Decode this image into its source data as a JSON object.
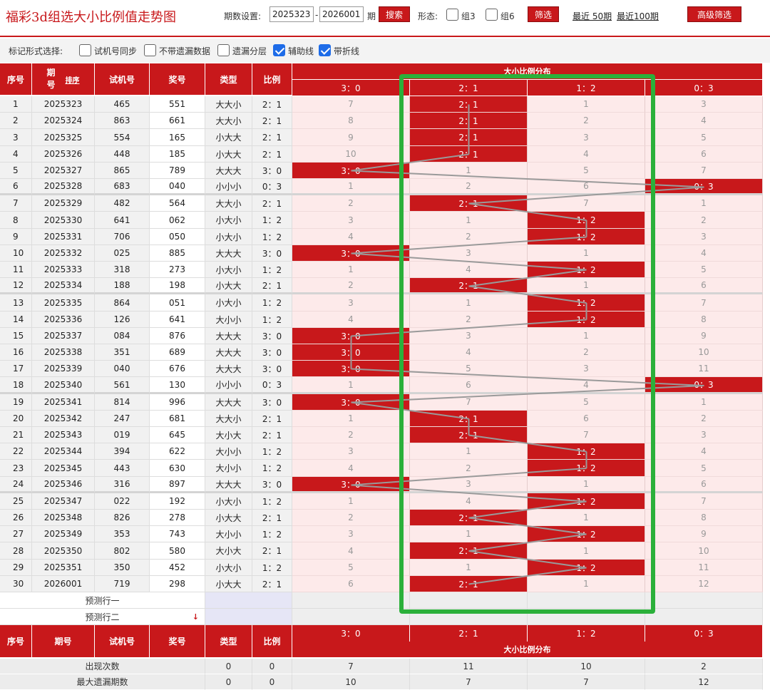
{
  "header": {
    "title": "福彩3d组选大小比例值走势图",
    "period_label": "期数设置:",
    "period_from": "2025323",
    "period_dash": "-",
    "period_to": "2026001",
    "period_unit": "期",
    "search_btn": "搜索",
    "shape_label": "形态:",
    "shape_opts": [
      "组3",
      "组6"
    ],
    "filter_btn": "筛选",
    "recent50": "最近 50期",
    "recent100": "最近100期",
    "advanced_btn": "高级筛选"
  },
  "marks": {
    "label": "标记形式选择:",
    "options": [
      {
        "label": "试机号同步",
        "checked": false
      },
      {
        "label": "不带遗漏数据",
        "checked": false
      },
      {
        "label": "遗漏分层",
        "checked": false
      },
      {
        "label": "辅助线",
        "checked": true
      },
      {
        "label": "带折线",
        "checked": true
      }
    ]
  },
  "table": {
    "headers": {
      "seq": "序号",
      "issue": "期号",
      "sort": "排序",
      "trial": "试机号",
      "prize": "奖号",
      "type": "类型",
      "ratio": "比例",
      "dist": "大小比例分布"
    },
    "dist_cols": [
      "3：0",
      "2：1",
      "1：2",
      "0：3"
    ],
    "rows": [
      {
        "seq": "1",
        "issue": "2025323",
        "trial": "465",
        "prize": "551",
        "type": "大大小",
        "ratio": "2：1",
        "dist": [
          "7",
          "2：1",
          "1",
          "3"
        ],
        "hit": 1
      },
      {
        "seq": "2",
        "issue": "2025324",
        "trial": "863",
        "prize": "661",
        "type": "大大小",
        "ratio": "2：1",
        "dist": [
          "8",
          "2：1",
          "2",
          "4"
        ],
        "hit": 1
      },
      {
        "seq": "3",
        "issue": "2025325",
        "trial": "554",
        "prize": "165",
        "type": "小大大",
        "ratio": "2：1",
        "dist": [
          "9",
          "2：1",
          "3",
          "5"
        ],
        "hit": 1
      },
      {
        "seq": "4",
        "issue": "2025326",
        "trial": "448",
        "prize": "185",
        "type": "小大大",
        "ratio": "2：1",
        "dist": [
          "10",
          "2：1",
          "4",
          "6"
        ],
        "hit": 1
      },
      {
        "seq": "5",
        "issue": "2025327",
        "trial": "865",
        "prize": "789",
        "type": "大大大",
        "ratio": "3：0",
        "dist": [
          "3：0",
          "1",
          "5",
          "7"
        ],
        "hit": 0
      },
      {
        "seq": "6",
        "issue": "2025328",
        "trial": "683",
        "prize": "040",
        "type": "小小小",
        "ratio": "0：3",
        "dist": [
          "1",
          "2",
          "6",
          "0：3"
        ],
        "hit": 3
      },
      {
        "seq": "7",
        "issue": "2025329",
        "trial": "482",
        "prize": "564",
        "type": "大大小",
        "ratio": "2：1",
        "dist": [
          "2",
          "2：1",
          "7",
          "1"
        ],
        "hit": 1
      },
      {
        "seq": "8",
        "issue": "2025330",
        "trial": "641",
        "prize": "062",
        "type": "小大小",
        "ratio": "1：2",
        "dist": [
          "3",
          "1",
          "1：2",
          "2"
        ],
        "hit": 2
      },
      {
        "seq": "9",
        "issue": "2025331",
        "trial": "706",
        "prize": "050",
        "type": "小大小",
        "ratio": "1：2",
        "dist": [
          "4",
          "2",
          "1：2",
          "3"
        ],
        "hit": 2
      },
      {
        "seq": "10",
        "issue": "2025332",
        "trial": "025",
        "prize": "885",
        "type": "大大大",
        "ratio": "3：0",
        "dist": [
          "3：0",
          "3",
          "1",
          "4"
        ],
        "hit": 0
      },
      {
        "seq": "11",
        "issue": "2025333",
        "trial": "318",
        "prize": "273",
        "type": "小大小",
        "ratio": "1：2",
        "dist": [
          "1",
          "4",
          "1：2",
          "5"
        ],
        "hit": 2
      },
      {
        "seq": "12",
        "issue": "2025334",
        "trial": "188",
        "prize": "198",
        "type": "小大大",
        "ratio": "2：1",
        "dist": [
          "2",
          "2：1",
          "1",
          "6"
        ],
        "hit": 1
      },
      {
        "seq": "13",
        "issue": "2025335",
        "trial": "864",
        "prize": "051",
        "type": "小大小",
        "ratio": "1：2",
        "dist": [
          "3",
          "1",
          "1：2",
          "7"
        ],
        "hit": 2
      },
      {
        "seq": "14",
        "issue": "2025336",
        "trial": "126",
        "prize": "641",
        "type": "大小小",
        "ratio": "1：2",
        "dist": [
          "4",
          "2",
          "1：2",
          "8"
        ],
        "hit": 2
      },
      {
        "seq": "15",
        "issue": "2025337",
        "trial": "084",
        "prize": "876",
        "type": "大大大",
        "ratio": "3：0",
        "dist": [
          "3：0",
          "3",
          "1",
          "9"
        ],
        "hit": 0
      },
      {
        "seq": "16",
        "issue": "2025338",
        "trial": "351",
        "prize": "689",
        "type": "大大大",
        "ratio": "3：0",
        "dist": [
          "3：0",
          "4",
          "2",
          "10"
        ],
        "hit": 0
      },
      {
        "seq": "17",
        "issue": "2025339",
        "trial": "040",
        "prize": "676",
        "type": "大大大",
        "ratio": "3：0",
        "dist": [
          "3：0",
          "5",
          "3",
          "11"
        ],
        "hit": 0
      },
      {
        "seq": "18",
        "issue": "2025340",
        "trial": "561",
        "prize": "130",
        "type": "小小小",
        "ratio": "0：3",
        "dist": [
          "1",
          "6",
          "4",
          "0：3"
        ],
        "hit": 3
      },
      {
        "seq": "19",
        "issue": "2025341",
        "trial": "814",
        "prize": "996",
        "type": "大大大",
        "ratio": "3：0",
        "dist": [
          "3：0",
          "7",
          "5",
          "1"
        ],
        "hit": 0
      },
      {
        "seq": "20",
        "issue": "2025342",
        "trial": "247",
        "prize": "681",
        "type": "大大小",
        "ratio": "2：1",
        "dist": [
          "1",
          "2：1",
          "6",
          "2"
        ],
        "hit": 1
      },
      {
        "seq": "21",
        "issue": "2025343",
        "trial": "019",
        "prize": "645",
        "type": "大小大",
        "ratio": "2：1",
        "dist": [
          "2",
          "2：1",
          "7",
          "3"
        ],
        "hit": 1
      },
      {
        "seq": "22",
        "issue": "2025344",
        "trial": "394",
        "prize": "622",
        "type": "大小小",
        "ratio": "1：2",
        "dist": [
          "3",
          "1",
          "1：2",
          "4"
        ],
        "hit": 2
      },
      {
        "seq": "23",
        "issue": "2025345",
        "trial": "443",
        "prize": "630",
        "type": "大小小",
        "ratio": "1：2",
        "dist": [
          "4",
          "2",
          "1：2",
          "5"
        ],
        "hit": 2
      },
      {
        "seq": "24",
        "issue": "2025346",
        "trial": "316",
        "prize": "897",
        "type": "大大大",
        "ratio": "3：0",
        "dist": [
          "3：0",
          "3",
          "1",
          "6"
        ],
        "hit": 0
      },
      {
        "seq": "25",
        "issue": "2025347",
        "trial": "022",
        "prize": "192",
        "type": "小大小",
        "ratio": "1：2",
        "dist": [
          "1",
          "4",
          "1：2",
          "7"
        ],
        "hit": 2
      },
      {
        "seq": "26",
        "issue": "2025348",
        "trial": "826",
        "prize": "278",
        "type": "小大大",
        "ratio": "2：1",
        "dist": [
          "2",
          "2：1",
          "1",
          "8"
        ],
        "hit": 1
      },
      {
        "seq": "27",
        "issue": "2025349",
        "trial": "353",
        "prize": "743",
        "type": "大小小",
        "ratio": "1：2",
        "dist": [
          "3",
          "1",
          "1：2",
          "9"
        ],
        "hit": 2
      },
      {
        "seq": "28",
        "issue": "2025350",
        "trial": "802",
        "prize": "580",
        "type": "大小大",
        "ratio": "2：1",
        "dist": [
          "4",
          "2：1",
          "1",
          "10"
        ],
        "hit": 1
      },
      {
        "seq": "29",
        "issue": "2025351",
        "trial": "350",
        "prize": "452",
        "type": "小大小",
        "ratio": "1：2",
        "dist": [
          "5",
          "1",
          "1：2",
          "11"
        ],
        "hit": 2
      },
      {
        "seq": "30",
        "issue": "2026001",
        "trial": "719",
        "prize": "298",
        "type": "小大大",
        "ratio": "2：1",
        "dist": [
          "6",
          "2：1",
          "1",
          "12"
        ],
        "hit": 1
      }
    ],
    "predict": [
      "预测行一",
      "预测行二"
    ],
    "stats": [
      {
        "label": "出现次数",
        "type": "0",
        "ratio": "0",
        "values": [
          "7",
          "11",
          "10",
          "2"
        ]
      },
      {
        "label": "最大遗漏期数",
        "type": "0",
        "ratio": "0",
        "values": [
          "10",
          "7",
          "7",
          "12"
        ]
      }
    ]
  },
  "colors": {
    "accent": "#c8181b",
    "highlight_box": "#2bb03a",
    "trend_line": "#9a9a9a",
    "check": "#1e6ce8"
  }
}
